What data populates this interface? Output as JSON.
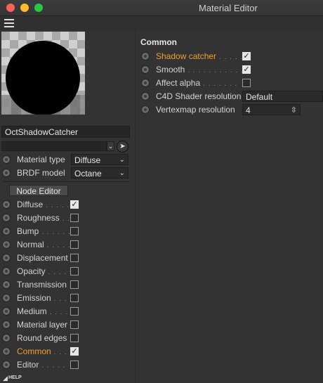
{
  "window": {
    "title": "Material Editor"
  },
  "material": {
    "name": "OctShadowCatcher",
    "link_value": ""
  },
  "left": {
    "params": [
      {
        "label": "Material type",
        "value": "Diffuse"
      },
      {
        "label": "BRDF model",
        "value": "Octane"
      }
    ],
    "node_editor_label": "Node Editor",
    "channels": [
      {
        "label": "Diffuse",
        "dots": ". . . . .",
        "checked": true,
        "active": false
      },
      {
        "label": "Roughness",
        "dots": ". .",
        "checked": false,
        "active": false
      },
      {
        "label": "Bump",
        "dots": ". . . . . .",
        "checked": false,
        "active": false
      },
      {
        "label": "Normal",
        "dots": ". . . . .",
        "checked": false,
        "active": false
      },
      {
        "label": "Displacement",
        "dots": "",
        "checked": false,
        "active": false
      },
      {
        "label": "Opacity",
        "dots": ". . . .",
        "checked": false,
        "active": false
      },
      {
        "label": "Transmission",
        "dots": "",
        "checked": false,
        "active": false
      },
      {
        "label": "Emission",
        "dots": ". . .",
        "checked": false,
        "active": false
      },
      {
        "label": "Medium",
        "dots": ". . . .",
        "checked": false,
        "active": false
      },
      {
        "label": "Material layer",
        "dots": "",
        "checked": false,
        "active": false
      },
      {
        "label": "Round edges",
        "dots": "",
        "checked": false,
        "active": false
      },
      {
        "label": "Common",
        "dots": ". . . .",
        "checked": true,
        "active": true
      },
      {
        "label": "Editor",
        "dots": ". . . . .",
        "checked": false,
        "active": false
      }
    ],
    "help_label": "HELP"
  },
  "right": {
    "section_title": "Common",
    "rows": [
      {
        "label": "Shadow catcher",
        "dots": ". . . . .",
        "control": "checkbox",
        "checked": true,
        "accent": true
      },
      {
        "label": "Smooth",
        "dots": ". . . . . . . . . . .",
        "control": "checkbox",
        "checked": true,
        "accent": false
      },
      {
        "label": "Affect alpha",
        "dots": ". . . . . . .",
        "control": "checkbox",
        "checked": false,
        "accent": false
      },
      {
        "label": "C4D Shader resolution",
        "dots": "",
        "control": "select",
        "value": "Default",
        "accent": false
      },
      {
        "label": "Vertexmap resolution",
        "dots": "",
        "control": "number",
        "value": "4",
        "accent": false
      }
    ]
  },
  "colors": {
    "accent": "#f0a030",
    "background": "#333333",
    "field": "#262626"
  }
}
